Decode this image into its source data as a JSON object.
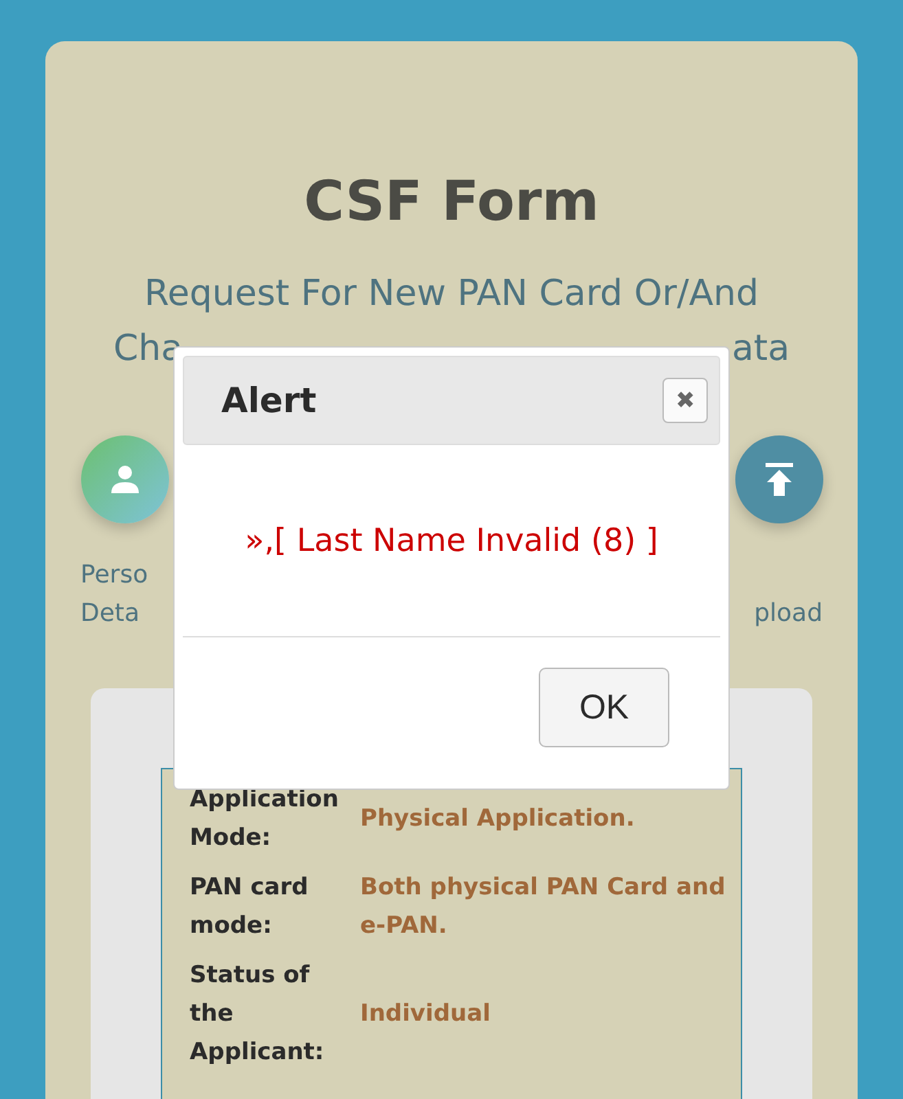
{
  "page": {
    "title": "CSF Form",
    "subtitle": "Request For New PAN Card Or/And",
    "subtitle_visible_parts": [
      "Cha",
      "ata"
    ]
  },
  "steps": [
    {
      "lines": [
        "Perso",
        "Deta"
      ],
      "kind": "person"
    },
    {
      "lines": [
        "pload"
      ],
      "kind": "upload"
    }
  ],
  "summary": [
    {
      "label": "Application Mode:",
      "value": "Physical Application."
    },
    {
      "label": "PAN card mode:",
      "value": "Both physical PAN Card and e-PAN."
    },
    {
      "label": "Status of the Applicant:",
      "value": "Individual"
    }
  ],
  "dialog": {
    "title": "Alert",
    "close": "✖",
    "message": "»,[ Last Name Invalid (8) ]",
    "button": "OK"
  }
}
